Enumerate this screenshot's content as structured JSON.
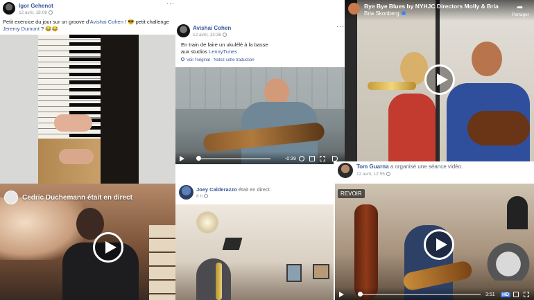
{
  "posts": {
    "igor": {
      "name": "Igor Gehenot",
      "time": "12 avril, 18:08",
      "text_prefix": "Petit exercice du jour sur un groove d'",
      "mention_1": "Avishai Cohen",
      "text_middle": " ! 😎 petit challenge",
      "mention_2": "Jeremy Dumont",
      "text_suffix": " ? 😂😂",
      "more": "···"
    },
    "avishai": {
      "name": "Avishai Cohen",
      "time": "12 avril, 13:36",
      "text_line_1": "En train de faire un ukulélé à la basse",
      "text_line_2_prefix": "aux studios ",
      "mention": "LennyTunes",
      "see_original": "Voir l'original",
      "rate_translation": "Notez cette traduction",
      "time_remaining": "-0:39",
      "more": "···"
    },
    "byebye": {
      "title": "Bye Bye Blues by NYHJC Directors Molly & Bria",
      "subtitle": "Bria Skonberg",
      "share": "Partager"
    },
    "tom": {
      "name": "Tom Guarna",
      "action": " a organisé une séance vidéo.",
      "time": "12 avril, 12:55",
      "replay": "REVOIR",
      "duration": "3:51",
      "hd": "HD"
    },
    "cedric": {
      "title": "Cedric Duchemann était en direct"
    },
    "joey": {
      "name": "Joey Calderazzo",
      "action": " était en direct.",
      "time": "8 h"
    }
  }
}
